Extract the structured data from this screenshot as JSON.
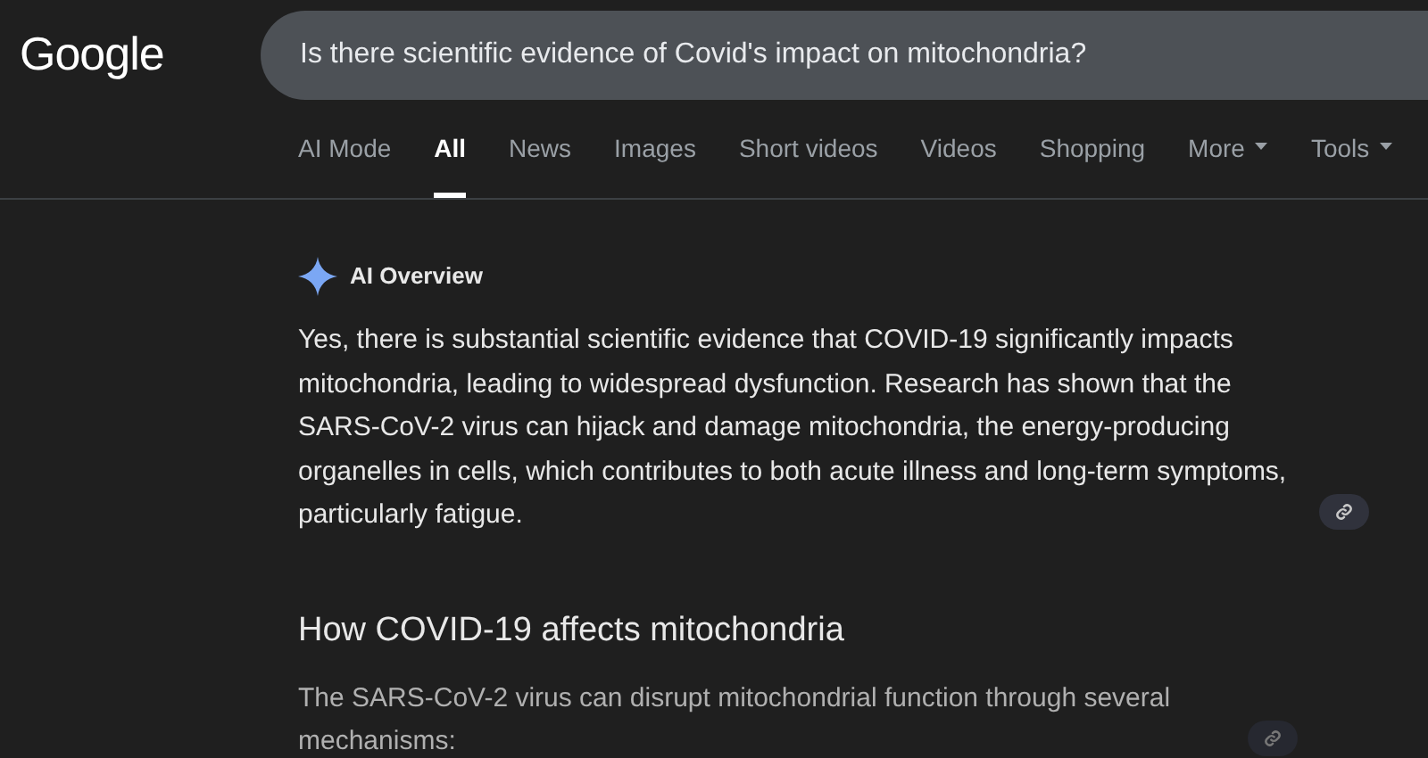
{
  "logo": "Google",
  "search": {
    "value": "Is there scientific evidence of Covid's impact on mitochondria?"
  },
  "tabs": [
    {
      "label": "AI Mode",
      "selected": false,
      "menu": false
    },
    {
      "label": "All",
      "selected": true,
      "menu": false
    },
    {
      "label": "News",
      "selected": false,
      "menu": false
    },
    {
      "label": "Images",
      "selected": false,
      "menu": false
    },
    {
      "label": "Short videos",
      "selected": false,
      "menu": false
    },
    {
      "label": "Videos",
      "selected": false,
      "menu": false
    },
    {
      "label": "Shopping",
      "selected": false,
      "menu": false
    },
    {
      "label": "More",
      "selected": false,
      "menu": true
    },
    {
      "label": "Tools",
      "selected": false,
      "menu": true
    }
  ],
  "overview": {
    "title": "AI Overview",
    "summary": "Yes, there is substantial scientific evidence that COVID-19 significantly impacts mitochondria, leading to widespread dysfunction. Research has shown that the SARS-CoV-2 virus can hijack and damage mitochondria, the energy-producing organelles in cells, which contributes to both acute illness and long-term symptoms, particularly fatigue.",
    "heading": "How COVID-19 affects mitochondria",
    "intro": "The SARS-CoV-2 virus can disrupt mitochondrial function through several mechanisms:"
  }
}
